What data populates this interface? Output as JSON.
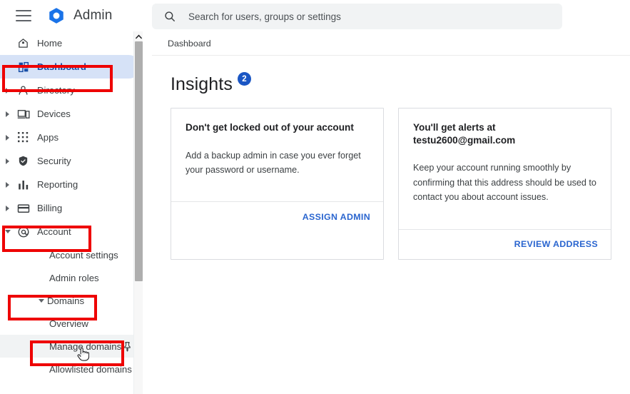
{
  "topbar": {
    "menu_icon": "hamburger-menu-icon",
    "logo_icon": "google-admin-logo-icon",
    "brand": "Admin",
    "search": {
      "icon": "search-icon",
      "placeholder": "Search for users, groups or settings",
      "value": ""
    }
  },
  "sidebar": {
    "scrollbar": {
      "up_arrow_icon": "chevron-up-icon"
    },
    "items": [
      {
        "label": "Home",
        "icon": "home-icon",
        "expandable": false,
        "expanded": false,
        "selected": false
      },
      {
        "label": "Dashboard",
        "icon": "dashboard-icon",
        "expandable": false,
        "expanded": false,
        "selected": true
      },
      {
        "label": "Directory",
        "icon": "person-icon",
        "expandable": true,
        "expanded": false,
        "selected": false
      },
      {
        "label": "Devices",
        "icon": "devices-icon",
        "expandable": true,
        "expanded": false,
        "selected": false
      },
      {
        "label": "Apps",
        "icon": "apps-grid-icon",
        "expandable": true,
        "expanded": false,
        "selected": false
      },
      {
        "label": "Security",
        "icon": "shield-icon",
        "expandable": true,
        "expanded": false,
        "selected": false
      },
      {
        "label": "Reporting",
        "icon": "bar-chart-icon",
        "expandable": true,
        "expanded": false,
        "selected": false
      },
      {
        "label": "Billing",
        "icon": "credit-card-icon",
        "expandable": true,
        "expanded": false,
        "selected": false
      },
      {
        "label": "Account",
        "icon": "at-sign-icon",
        "expandable": true,
        "expanded": true,
        "selected": false
      }
    ],
    "account_children": [
      {
        "label": "Account settings"
      },
      {
        "label": "Admin roles"
      }
    ],
    "domains": {
      "label": "Domains",
      "expanded": true
    },
    "domains_children": [
      {
        "label": "Overview",
        "hovered": false,
        "pin_icon": null
      },
      {
        "label": "Manage domains",
        "hovered": true,
        "pin_icon": "pin-icon"
      },
      {
        "label": "Allowlisted domains",
        "hovered": false,
        "pin_icon": null
      }
    ]
  },
  "main": {
    "breadcrumb": "Dashboard",
    "insights": {
      "title": "Insights",
      "badge_count": "2"
    },
    "cards": [
      {
        "title": "Don't get locked out of your account",
        "description": "Add a backup admin in case you ever forget your password or username.",
        "action": "ASSIGN ADMIN"
      },
      {
        "title": "You'll get alerts at testu2600@gmail.com",
        "description": "Keep your account running smoothly by confirming that this address should be used to contact you about account issues.",
        "action": "REVIEW ADDRESS"
      }
    ]
  },
  "annotations": {
    "color": "#ee0000",
    "boxes": [
      {
        "target": "Dashboard"
      },
      {
        "target": "Account"
      },
      {
        "target": "Domains"
      },
      {
        "target": "Manage domains"
      }
    ]
  },
  "cursor": {
    "icon": "pointing-hand-cursor"
  },
  "colors": {
    "accent_blue": "#1a73e8",
    "link_blue": "#2a65cf",
    "selected_bg": "#d6e2f7",
    "selected_text": "#174ea6",
    "badge_blue": "#1a56c4",
    "annotation_red": "#ee0000",
    "search_bg": "#f1f3f4"
  }
}
